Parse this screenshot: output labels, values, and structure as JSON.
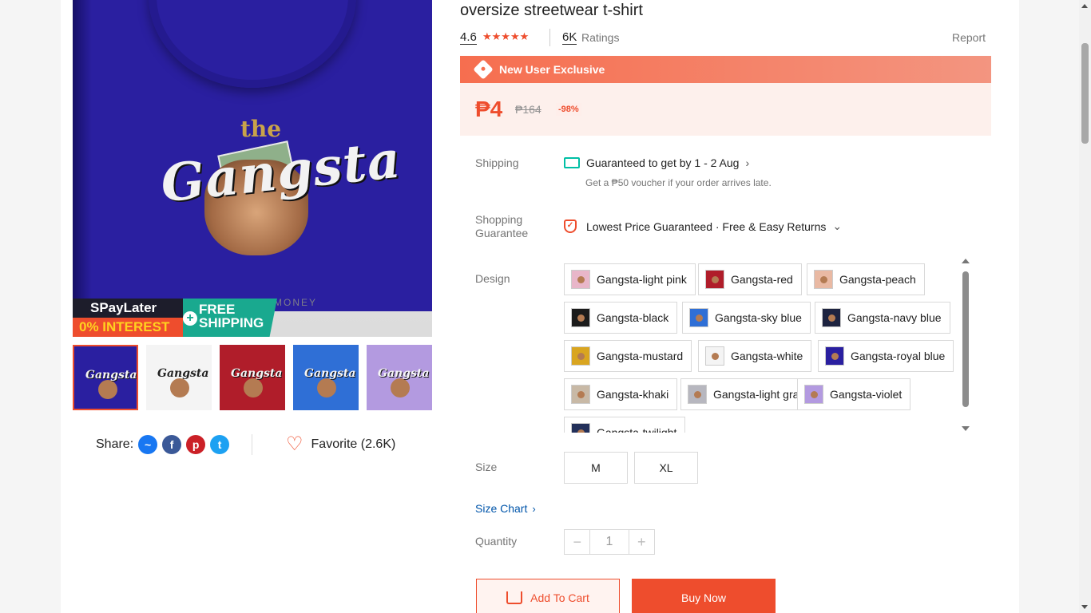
{
  "product": {
    "title": "oversize streetwear t-shirt",
    "rating": "4.6",
    "stars": "★★★★★",
    "ratings_count": "6K",
    "ratings_label": "Ratings",
    "report": "Report"
  },
  "image": {
    "art_small": "the",
    "art_main": "Gangsta",
    "art_money": "MONEY",
    "badge_spaylater": "SPayLater",
    "badge_interest": "0% INTEREST",
    "badge_plus": "+",
    "badge_free": "FREE",
    "badge_shipping": "SHIPPING"
  },
  "thumbnails": [
    {
      "color": "#2a1fa0",
      "label": "Gangsta"
    },
    {
      "color": "#f4f4f4",
      "label": "Gangsta"
    },
    {
      "color": "#b01d2a",
      "label": "Gangsta"
    },
    {
      "color": "#2f6fd6",
      "label": "Gangsta"
    },
    {
      "color": "#b39ae0",
      "label": "Gangsta"
    }
  ],
  "share": {
    "label": "Share:",
    "icons": [
      "messenger-icon",
      "facebook-icon",
      "pinterest-icon",
      "twitter-icon"
    ],
    "favorite": "Favorite (2.6K)"
  },
  "promo": {
    "label": "New User Exclusive",
    "price": "₱4",
    "original_price": "₱164",
    "discount": "-98%"
  },
  "shipping": {
    "label": "Shipping",
    "line": "Guaranteed to get by 1 - 2 Aug",
    "sub": "Get a ₱50 voucher if your order arrives late."
  },
  "guarantee": {
    "label_line1": "Shopping",
    "label_line2": "Guarantee",
    "line": "Lowest Price Guaranteed · Free & Easy Returns"
  },
  "design": {
    "label": "Design",
    "options": [
      {
        "label": "Gangsta-light pink",
        "swatch": "#e8b6c9"
      },
      {
        "label": "Gangsta-red",
        "swatch": "#b01d2a"
      },
      {
        "label": "Gangsta-peach",
        "swatch": "#e9b9a3"
      },
      {
        "label": "Gangsta-black",
        "swatch": "#1b1b1b"
      },
      {
        "label": "Gangsta-sky blue",
        "swatch": "#2f6fd6"
      },
      {
        "label": "Gangsta-navy blue",
        "swatch": "#1d2340"
      },
      {
        "label": "Gangsta-mustard",
        "swatch": "#d9a520"
      },
      {
        "label": "Gangsta-white",
        "swatch": "#f4f4f4"
      },
      {
        "label": "Gangsta-royal blue",
        "swatch": "#2a1fa0"
      },
      {
        "label": "Gangsta-khaki",
        "swatch": "#c8b9a6"
      },
      {
        "label": "Gangsta-light gray",
        "swatch": "#b7b7bf"
      },
      {
        "label": "Gangsta-violet",
        "swatch": "#b39ae0"
      },
      {
        "label": "Gangsta-twilight",
        "swatch": "#23305a"
      }
    ]
  },
  "size": {
    "label": "Size",
    "options": [
      "M",
      "XL"
    ],
    "chart": "Size Chart"
  },
  "quantity": {
    "label": "Quantity",
    "value": "1",
    "minus": "−",
    "plus": "+"
  },
  "actions": {
    "add_to_cart": "Add To Cart",
    "buy_now": "Buy Now"
  },
  "colors": {
    "accent": "#ee4d2d",
    "shipping_icon": "#00bfa5"
  }
}
